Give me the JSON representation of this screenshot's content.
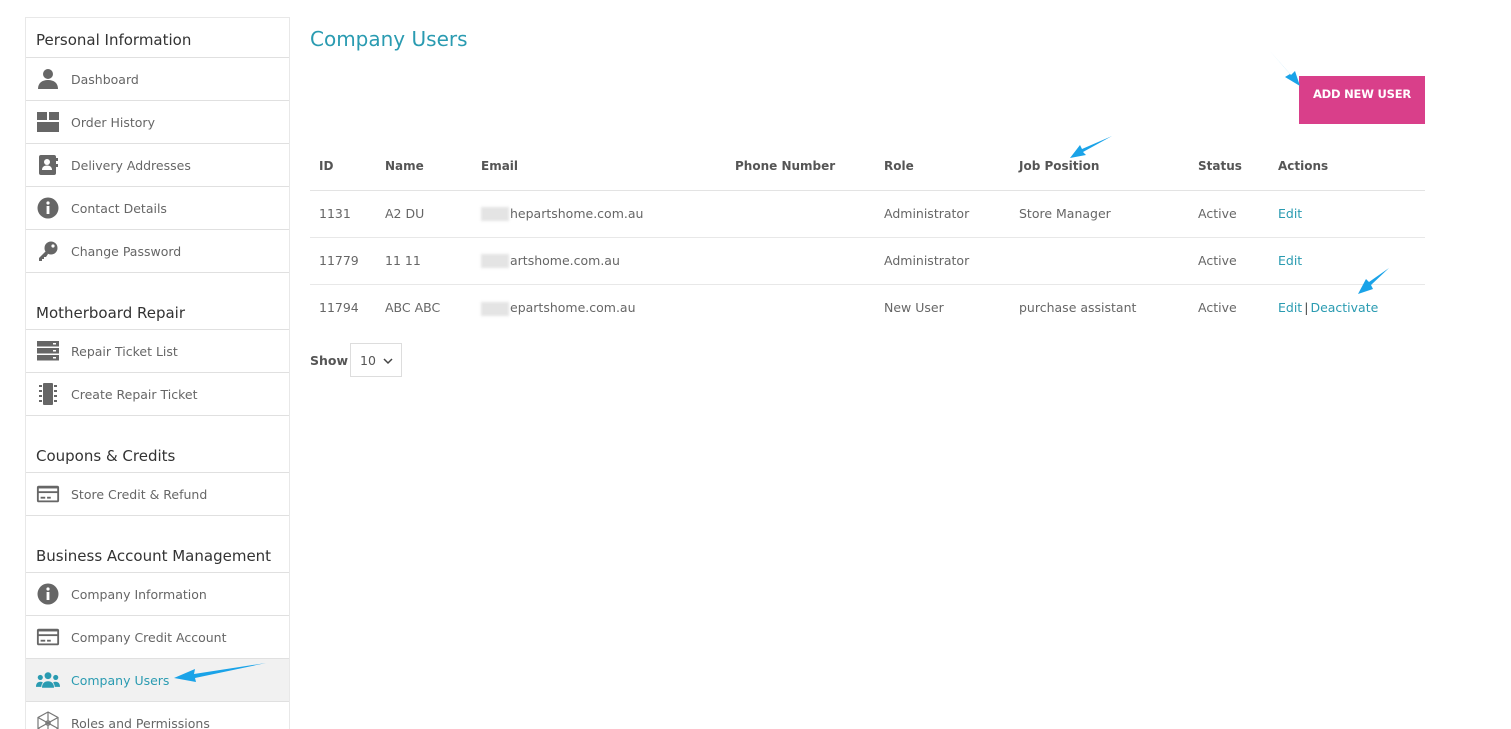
{
  "sidebar": {
    "sections": [
      {
        "title": "Personal Information",
        "items": [
          {
            "label": "Dashboard",
            "icon": "user-icon"
          },
          {
            "label": "Order History",
            "icon": "box-icon"
          },
          {
            "label": "Delivery Addresses",
            "icon": "address-book-icon"
          },
          {
            "label": "Contact Details",
            "icon": "info-icon"
          },
          {
            "label": "Change Password",
            "icon": "key-icon"
          }
        ]
      },
      {
        "title": "Motherboard Repair",
        "items": [
          {
            "label": "Repair Ticket List",
            "icon": "server-list-icon"
          },
          {
            "label": "Create Repair Ticket",
            "icon": "chip-icon"
          }
        ]
      },
      {
        "title": "Coupons & Credits",
        "items": [
          {
            "label": "Store Credit & Refund",
            "icon": "credit-card-icon"
          }
        ]
      },
      {
        "title": "Business Account Management",
        "items": [
          {
            "label": "Company Information",
            "icon": "info-icon"
          },
          {
            "label": "Company Credit Account",
            "icon": "credit-card-icon"
          },
          {
            "label": "Company Users",
            "icon": "users-icon",
            "active": true
          },
          {
            "label": "Roles and Permissions",
            "icon": "network-icon"
          }
        ]
      }
    ]
  },
  "main": {
    "title": "Company Users",
    "add_button": "ADD NEW USER",
    "table": {
      "columns": [
        "ID",
        "Name",
        "Email",
        "Phone Number",
        "Role",
        "Job Position",
        "Status",
        "Actions"
      ],
      "rows": [
        {
          "id": "1131",
          "name": "A2 DU",
          "email": "hepartshome.com.au",
          "phone": "",
          "role": "Administrator",
          "job": "Store Manager",
          "status": "Active",
          "actions": [
            "Edit"
          ]
        },
        {
          "id": "11779",
          "name": "11 11",
          "email": "artshome.com.au",
          "phone": "",
          "role": "Administrator",
          "job": "",
          "status": "Active",
          "actions": [
            "Edit"
          ]
        },
        {
          "id": "11794",
          "name": "ABC ABC",
          "email": "epartshome.com.au",
          "phone": "",
          "role": "New User",
          "job": "purchase assistant",
          "status": "Active",
          "actions": [
            "Edit",
            "Deactivate"
          ]
        }
      ]
    },
    "pagination": {
      "show_label": "Show",
      "page_size": "10"
    }
  },
  "colors": {
    "accent": "#2a9bb1",
    "button": "#d93f8a",
    "annotation": "#1aa3e8"
  }
}
